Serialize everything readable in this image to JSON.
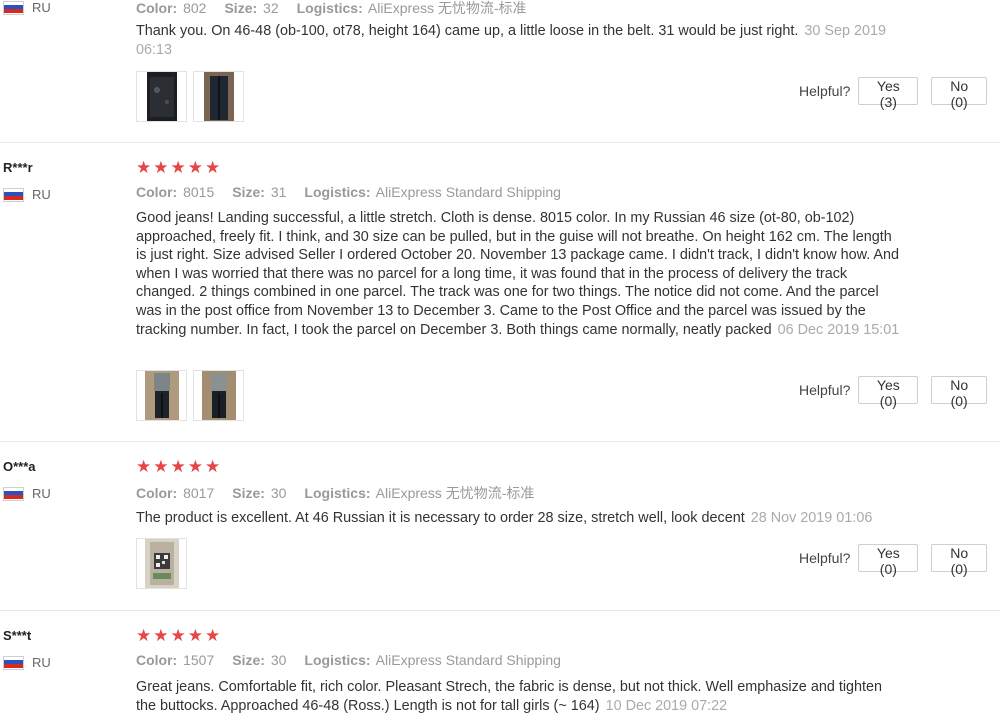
{
  "labels": {
    "color": "Color:",
    "size": "Size:",
    "logistics": "Logistics:",
    "helpful": "Helpful?"
  },
  "colors": {
    "star": "#e64646",
    "meta_text": "#9a9a9a",
    "date": "#aaaaaa"
  },
  "reviews": [
    {
      "user": "",
      "country": "RU",
      "color": "802",
      "size": "32",
      "logistics": "AliExpress 无忧物流-标准",
      "text": "Thank you. On 46-48 (ob-100, ot78, height 164) came up, a little loose in the belt. 31 would be just right.",
      "date": "30 Sep 2019 06:13",
      "yes": "Yes (3)",
      "no": "No (0)"
    },
    {
      "user": "R***r",
      "country": "RU",
      "rating": 5,
      "color": "8015",
      "size": "31",
      "logistics": "AliExpress Standard Shipping",
      "text": "Good jeans! Landing successful, a little stretch. Cloth is dense. 8015 color. In my Russian 46 size (ot-80, ob-102) approached, freely fit. I think, and 30 size can be pulled, but in the guise will not breathe. On height 162 cm. The length is just right. Size advised Seller I ordered October 20. November 13 package came. I didn't track, I didn't know how. And when I was worried that there was no parcel for a long time, it was found that in the process of delivery the track changed. 2 things combined in one parcel. The track was one for two things. The notice did not come. And the parcel was in the post office from November 13 to December 3. Came to the Post Office and the parcel was issued by the tracking number. In fact, I took the parcel on December 3. Both things came normally, neatly packed",
      "date": "06 Dec 2019 15:01",
      "yes": "Yes (0)",
      "no": "No (0)"
    },
    {
      "user": "O***a",
      "country": "RU",
      "rating": 5,
      "color": "8017",
      "size": "30",
      "logistics": "AliExpress 无忧物流-标准",
      "text": "The product is excellent. At 46 Russian it is necessary to order 28 size, stretch well, look decent",
      "date": "28 Nov 2019 01:06",
      "yes": "Yes (0)",
      "no": "No (0)"
    },
    {
      "user": "S***t",
      "country": "RU",
      "rating": 5,
      "color": "1507",
      "size": "30",
      "logistics": "AliExpress Standard Shipping",
      "text": "Great jeans. Comfortable fit, rich color. Pleasant Strech, the fabric is dense, but not thick. Well emphasize and tighten the buttocks. Approached 46-48 (Ross.) Length is not for tall girls (~ 164)",
      "date": "10 Dec 2019 07:22"
    }
  ]
}
